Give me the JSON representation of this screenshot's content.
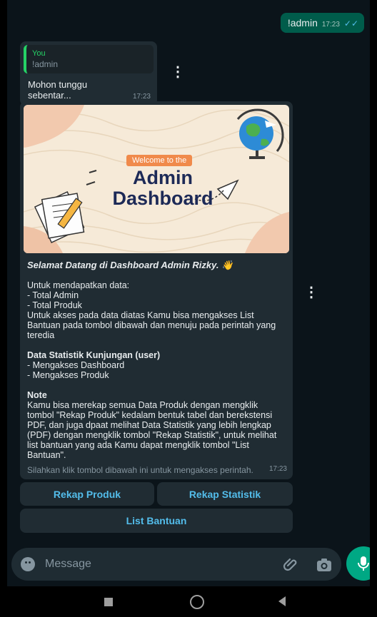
{
  "outgoing": {
    "text": "!admin",
    "time": "17:23",
    "ticks": "✓✓"
  },
  "reply_message": {
    "quote_author": "You",
    "quote_text": "!admin",
    "text": "Mohon tunggu sebentar...",
    "time": "17:23"
  },
  "kebab_glyph": "⋮",
  "media_message": {
    "banner": {
      "pill": "Welcome to the",
      "title_line1": "Admin",
      "title_line2": "Dashboard"
    },
    "greeting": "Selamat Datang di Dashboard Admin Rizky. 👋",
    "intro": "Untuk mendapatkan data:",
    "item1": "- Total Admin",
    "item2": "- Total Produk",
    "access_text": "Untuk akses pada data diatas Kamu bisa mengakses List Bantuan pada tombol dibawah dan menuju pada perintah yang teredia",
    "stats_heading": "Data Statistik Kunjungan (user)",
    "stats_item1": "- Mengakses Dashboard",
    "stats_item2": "- Mengakses Produk",
    "note_heading": "Note",
    "note_text": "Kamu bisa merekap semua Data Produk dengan mengklik tombol \"Rekap Produk\" kedalam bentuk tabel dan berekstensi PDF, dan juga dpaat melihat Data Statistik yang lebih lengkap (PDF) dengan mengklik tombol \"Rekap Statistik\", untuk melihat list bantuan yang ada Kamu dapat mengklik tombol \"List Bantuan\".",
    "footer": "Silahkan klik tombol dibawah ini untuk mengakses perintah.",
    "time": "17:23"
  },
  "buttons": {
    "rekap_produk": "Rekap Produk",
    "rekap_statistik": "Rekap Statistik",
    "list_bantuan": "List Bantuan"
  },
  "input": {
    "placeholder": "Message"
  },
  "colors": {
    "accent": "#00a884",
    "link": "#53bdeb",
    "bubble": "#202c33",
    "outgoing": "#005c4b"
  },
  "icons": [
    "emoji-icon",
    "paperclip-icon",
    "camera-icon",
    "mic-icon",
    "nav-recents-icon",
    "nav-home-icon",
    "nav-back-icon"
  ]
}
